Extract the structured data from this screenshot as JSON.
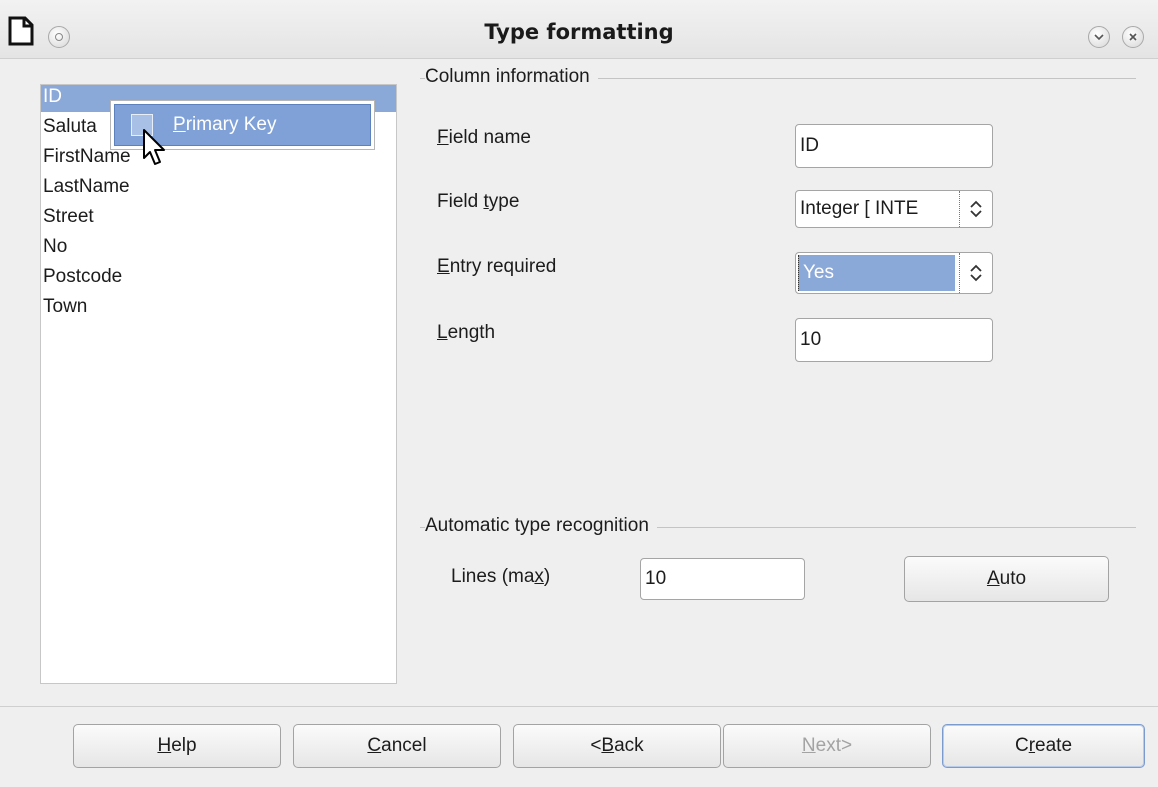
{
  "window": {
    "title": "Type formatting"
  },
  "field_list": {
    "items": [
      "ID",
      "Saluta",
      "FirstName",
      "LastName",
      "Street",
      "No",
      "Postcode",
      "Town"
    ],
    "selected": "ID"
  },
  "context_menu": {
    "primary_key_label": "Primary Key",
    "checked": false
  },
  "column_info": {
    "group_label": "Column information",
    "field_name_label": "Field name",
    "field_name_value": "ID",
    "field_type_label": "Field type",
    "field_type_value": "Integer [ INTE",
    "entry_required_label": "Entry required",
    "entry_required_value": "Yes",
    "length_label": "Length",
    "length_value": "10"
  },
  "auto_recognition": {
    "group_label": "Automatic type recognition",
    "lines_label": "Lines (max)",
    "lines_value": "10",
    "auto_button": "Auto"
  },
  "buttons": {
    "help": "Help",
    "cancel": "Cancel",
    "back": "< Back",
    "next": "Next>",
    "create": "Create"
  },
  "icons": {
    "app": "document-icon",
    "window_menu": "window-menu-icon",
    "minimize": "minimize-icon",
    "close": "close-icon",
    "cursor": "mouse-pointer-icon",
    "spin": "spin-arrows-icon"
  },
  "colors": {
    "selection": "#8ba9d8",
    "menu_highlight": "#7fa1d7"
  }
}
